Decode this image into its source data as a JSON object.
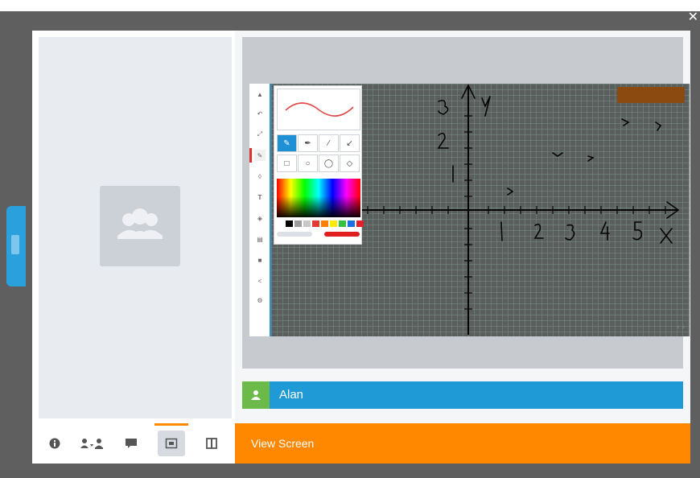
{
  "modal": {
    "close_icon": "close-icon",
    "participant": {
      "name": "Alan",
      "icon": "user-icon"
    },
    "view_screen_label": "View Screen"
  },
  "toolbar": {
    "items": [
      {
        "name": "info-icon",
        "active": false
      },
      {
        "name": "participants-icon",
        "active": false
      },
      {
        "name": "chat-icon",
        "active": false
      },
      {
        "name": "screen-share-icon",
        "active": true
      },
      {
        "name": "layout-icon",
        "active": false
      }
    ],
    "active_accent": "#ff8a00"
  },
  "whiteboard": {
    "tools": [
      "pointer-icon",
      "undo-icon",
      "expand-icon",
      "pen-icon",
      "eraser-icon",
      "text-icon",
      "shape-icon",
      "save-icon",
      "lock-icon",
      "share-icon",
      "settings-icon"
    ],
    "active_tool": "pen-icon",
    "pen_palette": {
      "stroke_color": "#e24b4b",
      "swatches": [
        "#ffffff",
        "#000000",
        "#9c9c9c",
        "#c8c8c8",
        "#e53935",
        "#ff7f00",
        "#ffeb00",
        "#34c240",
        "#1c6fe0",
        "#e0202a"
      ]
    }
  },
  "colors": {
    "accent_blue": "#1f9ad7",
    "accent_orange": "#ff8800",
    "user_badge": "#6cbb4a"
  }
}
